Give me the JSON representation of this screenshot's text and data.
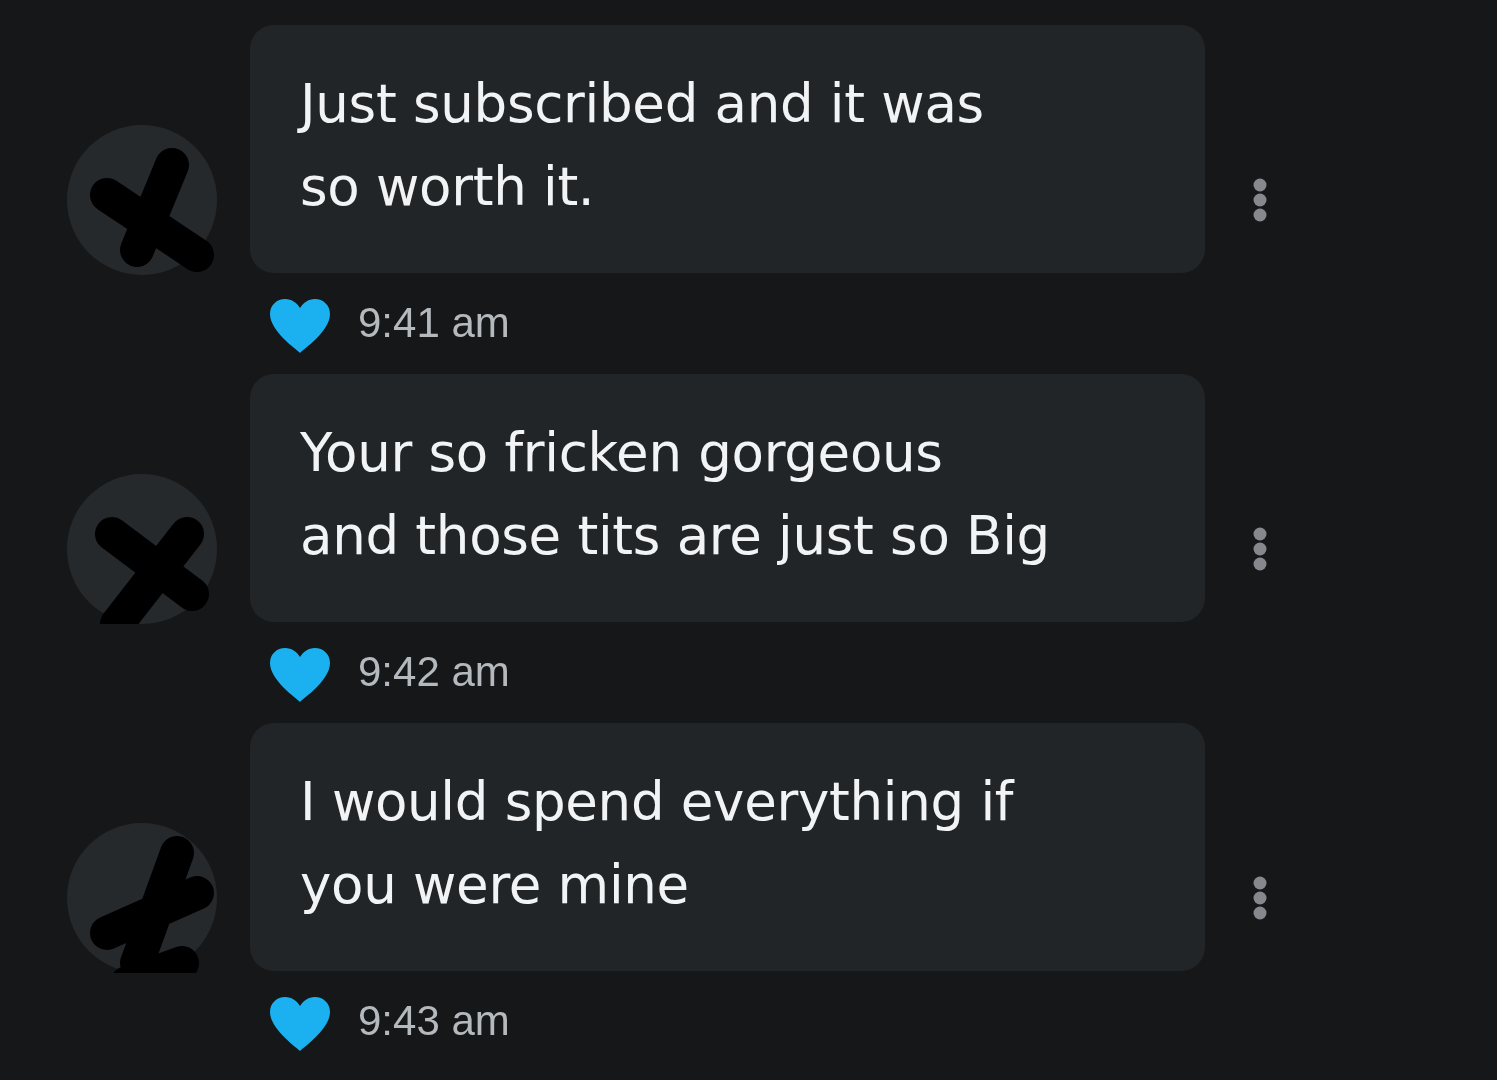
{
  "messages": [
    {
      "text": "Just subscribed and it was\nso worth it.",
      "liked": true,
      "time": "9:41 am"
    },
    {
      "text": "Your so fricken gorgeous\nand those tits are just so Big",
      "liked": true,
      "time": "9:42 am"
    },
    {
      "text": "I would spend everything if\nyou were mine",
      "liked": true,
      "time": "9:43 am"
    }
  ]
}
